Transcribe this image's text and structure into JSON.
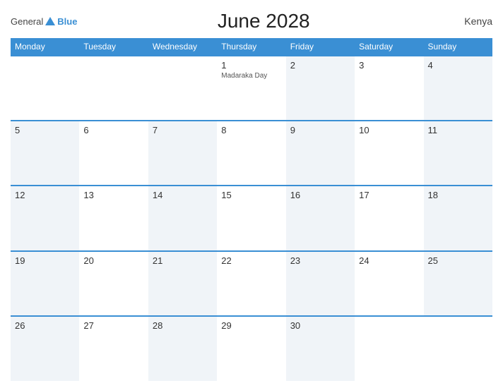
{
  "header": {
    "logo_general": "General",
    "logo_blue": "Blue",
    "title": "June 2028",
    "country": "Kenya"
  },
  "calendar": {
    "weekdays": [
      "Monday",
      "Tuesday",
      "Wednesday",
      "Thursday",
      "Friday",
      "Saturday",
      "Sunday"
    ],
    "weeks": [
      [
        {
          "day": "",
          "holiday": "",
          "empty": true
        },
        {
          "day": "",
          "holiday": "",
          "empty": true
        },
        {
          "day": "",
          "holiday": "",
          "empty": true
        },
        {
          "day": "1",
          "holiday": "Madaraka Day",
          "empty": false
        },
        {
          "day": "2",
          "holiday": "",
          "empty": false
        },
        {
          "day": "3",
          "holiday": "",
          "empty": false
        },
        {
          "day": "4",
          "holiday": "",
          "empty": false
        }
      ],
      [
        {
          "day": "5",
          "holiday": "",
          "empty": false
        },
        {
          "day": "6",
          "holiday": "",
          "empty": false
        },
        {
          "day": "7",
          "holiday": "",
          "empty": false
        },
        {
          "day": "8",
          "holiday": "",
          "empty": false
        },
        {
          "day": "9",
          "holiday": "",
          "empty": false
        },
        {
          "day": "10",
          "holiday": "",
          "empty": false
        },
        {
          "day": "11",
          "holiday": "",
          "empty": false
        }
      ],
      [
        {
          "day": "12",
          "holiday": "",
          "empty": false
        },
        {
          "day": "13",
          "holiday": "",
          "empty": false
        },
        {
          "day": "14",
          "holiday": "",
          "empty": false
        },
        {
          "day": "15",
          "holiday": "",
          "empty": false
        },
        {
          "day": "16",
          "holiday": "",
          "empty": false
        },
        {
          "day": "17",
          "holiday": "",
          "empty": false
        },
        {
          "day": "18",
          "holiday": "",
          "empty": false
        }
      ],
      [
        {
          "day": "19",
          "holiday": "",
          "empty": false
        },
        {
          "day": "20",
          "holiday": "",
          "empty": false
        },
        {
          "day": "21",
          "holiday": "",
          "empty": false
        },
        {
          "day": "22",
          "holiday": "",
          "empty": false
        },
        {
          "day": "23",
          "holiday": "",
          "empty": false
        },
        {
          "day": "24",
          "holiday": "",
          "empty": false
        },
        {
          "day": "25",
          "holiday": "",
          "empty": false
        }
      ],
      [
        {
          "day": "26",
          "holiday": "",
          "empty": false
        },
        {
          "day": "27",
          "holiday": "",
          "empty": false
        },
        {
          "day": "28",
          "holiday": "",
          "empty": false
        },
        {
          "day": "29",
          "holiday": "",
          "empty": false
        },
        {
          "day": "30",
          "holiday": "",
          "empty": false
        },
        {
          "day": "",
          "holiday": "",
          "empty": true
        },
        {
          "day": "",
          "holiday": "",
          "empty": true
        }
      ]
    ]
  }
}
